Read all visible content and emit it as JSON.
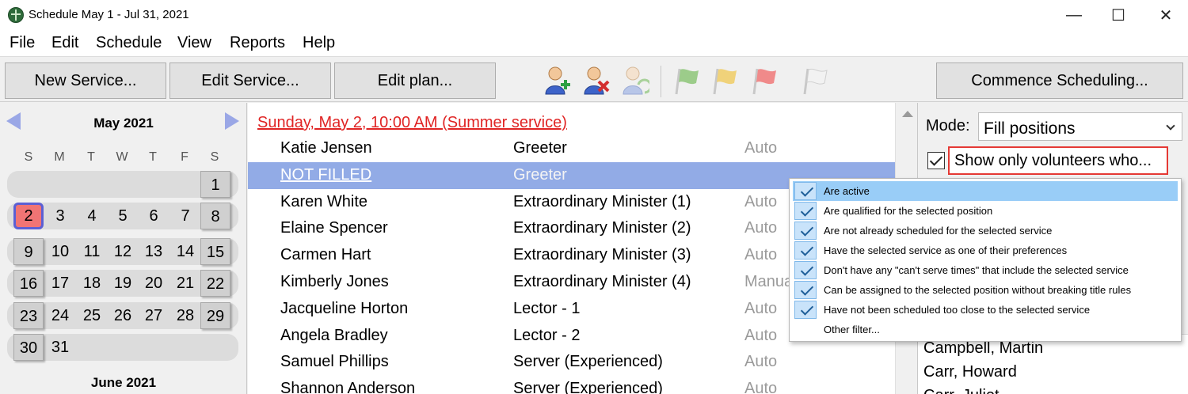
{
  "window": {
    "title": "Schedule May 1 - Jul 31, 2021",
    "minimize": "—",
    "maximize": "☐",
    "close": "✕"
  },
  "menu": [
    "File",
    "Edit",
    "Schedule",
    "View",
    "Reports",
    "Help"
  ],
  "toolbar": {
    "new_service": "New Service...",
    "edit_service": "Edit Service...",
    "edit_plan": "Edit plan...",
    "commence": "Commence Scheduling...",
    "icons": [
      "add-volunteer-icon",
      "remove-volunteer-icon",
      "swap-volunteer-icon",
      "green-flag-icon",
      "yellow-flag-icon",
      "red-flag-icon",
      "white-flag-icon"
    ],
    "colors": {
      "green_flag": "#9ccc8a",
      "yellow_flag": "#f0d27a",
      "red_flag": "#f08a8a",
      "white_flag": "#e8e8e8"
    }
  },
  "calendar": {
    "month": "May 2021",
    "next_month": "June 2021",
    "weekdays": [
      "S",
      "M",
      "T",
      "W",
      "T",
      "F",
      "S"
    ],
    "weeks": [
      [
        "",
        "",
        "",
        "",
        "",
        "",
        "1"
      ],
      [
        "2",
        "3",
        "4",
        "5",
        "6",
        "7",
        "8"
      ],
      [
        "9",
        "10",
        "11",
        "12",
        "13",
        "14",
        "15"
      ],
      [
        "16",
        "17",
        "18",
        "19",
        "20",
        "21",
        "22"
      ],
      [
        "23",
        "24",
        "25",
        "26",
        "27",
        "28",
        "29"
      ],
      [
        "30",
        "31",
        "",
        "",
        "",
        "",
        ""
      ]
    ],
    "selected_day": "2"
  },
  "service": {
    "header": "Sunday, May 2, 10:00 AM (Summer service)",
    "rows": [
      {
        "name": "Katie Jensen",
        "position": "Greeter",
        "mode": "Auto"
      },
      {
        "name": "NOT FILLED",
        "position": "Greeter",
        "mode": ""
      },
      {
        "name": "Karen White",
        "position": "Extraordinary Minister  (1)",
        "mode": "Auto"
      },
      {
        "name": "Elaine Spencer",
        "position": "Extraordinary Minister  (2)",
        "mode": "Auto"
      },
      {
        "name": "Carmen Hart",
        "position": "Extraordinary Minister  (3)",
        "mode": "Auto"
      },
      {
        "name": "Kimberly Jones",
        "position": "Extraordinary Minister  (4)",
        "mode": "Manual"
      },
      {
        "name": "Jacqueline Horton",
        "position": "Lector - 1",
        "mode": "Auto"
      },
      {
        "name": "Angela Bradley",
        "position": "Lector - 2",
        "mode": "Auto"
      },
      {
        "name": "Samuel Phillips",
        "position": "Server (Experienced)",
        "mode": "Auto"
      },
      {
        "name": "Shannon Anderson",
        "position": "Server (Experienced)",
        "mode": "Auto"
      }
    ]
  },
  "panel": {
    "mode_label": "Mode:",
    "mode_value": "Fill positions",
    "filter_label": "Show only volunteers who...",
    "volunteers": [
      "Campbell, Martin",
      "Carr, Howard",
      "Carr, Juliet..."
    ]
  },
  "filter_menu": {
    "items": [
      {
        "label": "Are active",
        "checked": true
      },
      {
        "label": "Are qualified for the selected position",
        "checked": true
      },
      {
        "label": "Are not already scheduled for the selected service",
        "checked": true
      },
      {
        "label": "Have the selected service as one of their preferences",
        "checked": true
      },
      {
        "label": "Don't have any \"can't serve times\" that include the selected service",
        "checked": true
      },
      {
        "label": "Can be assigned to the selected position without breaking title rules",
        "checked": true
      },
      {
        "label": "Have not been scheduled too close to the selected service",
        "checked": true
      },
      {
        "label": "Other filter...",
        "checked": false
      }
    ]
  }
}
